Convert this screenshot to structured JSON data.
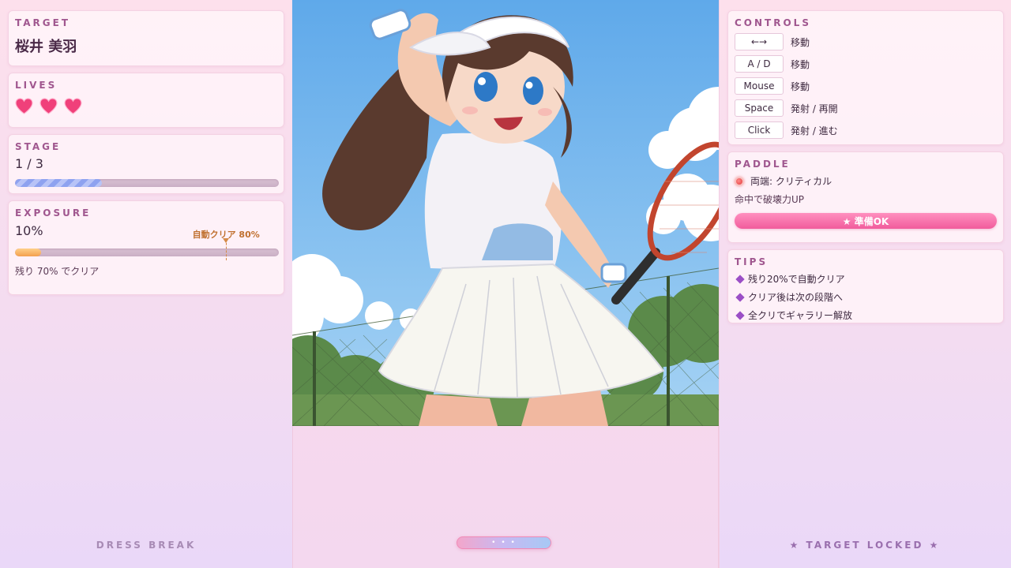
{
  "target": {
    "title": "TARGET",
    "name": "桜井 美羽"
  },
  "lives": {
    "title": "LIVES",
    "count": 3
  },
  "stage": {
    "title": "STAGE",
    "text": "1 / 3",
    "progress": 0.33
  },
  "exposure": {
    "title": "EXPOSURE",
    "value_text": "10%",
    "value": 0.1,
    "auto_clear_label": "自動クリア 80%",
    "auto_clear_at": 0.8,
    "remaining_text": "残り 70% でクリア"
  },
  "controls": {
    "title": "CONTROLS",
    "rows": [
      {
        "key": "←→",
        "action": "移動"
      },
      {
        "key": "A / D",
        "action": "移動"
      },
      {
        "key": "Mouse",
        "action": "移動"
      },
      {
        "key": "Space",
        "action": "発射 / 再開"
      },
      {
        "key": "Click",
        "action": "発射 / 進む"
      }
    ]
  },
  "paddle": {
    "title": "PADDLE",
    "mode": "両端: クリティカル",
    "description": "命中で破壊力UP",
    "ready_button": "★ 準備OK"
  },
  "tips": {
    "title": "TIPS",
    "items": [
      "残り20%で自動クリア",
      "クリア後は次の段階へ",
      "全クリでギャラリー解放"
    ]
  },
  "footer": {
    "left": "DRESS BREAK",
    "right": "★ TARGET LOCKED ★"
  },
  "paddle_handle": {
    "label": "• • •"
  },
  "colors": {
    "accent_pink": "#f15c9c",
    "title_purple": "#a0578f",
    "heart": "#f0407a"
  }
}
